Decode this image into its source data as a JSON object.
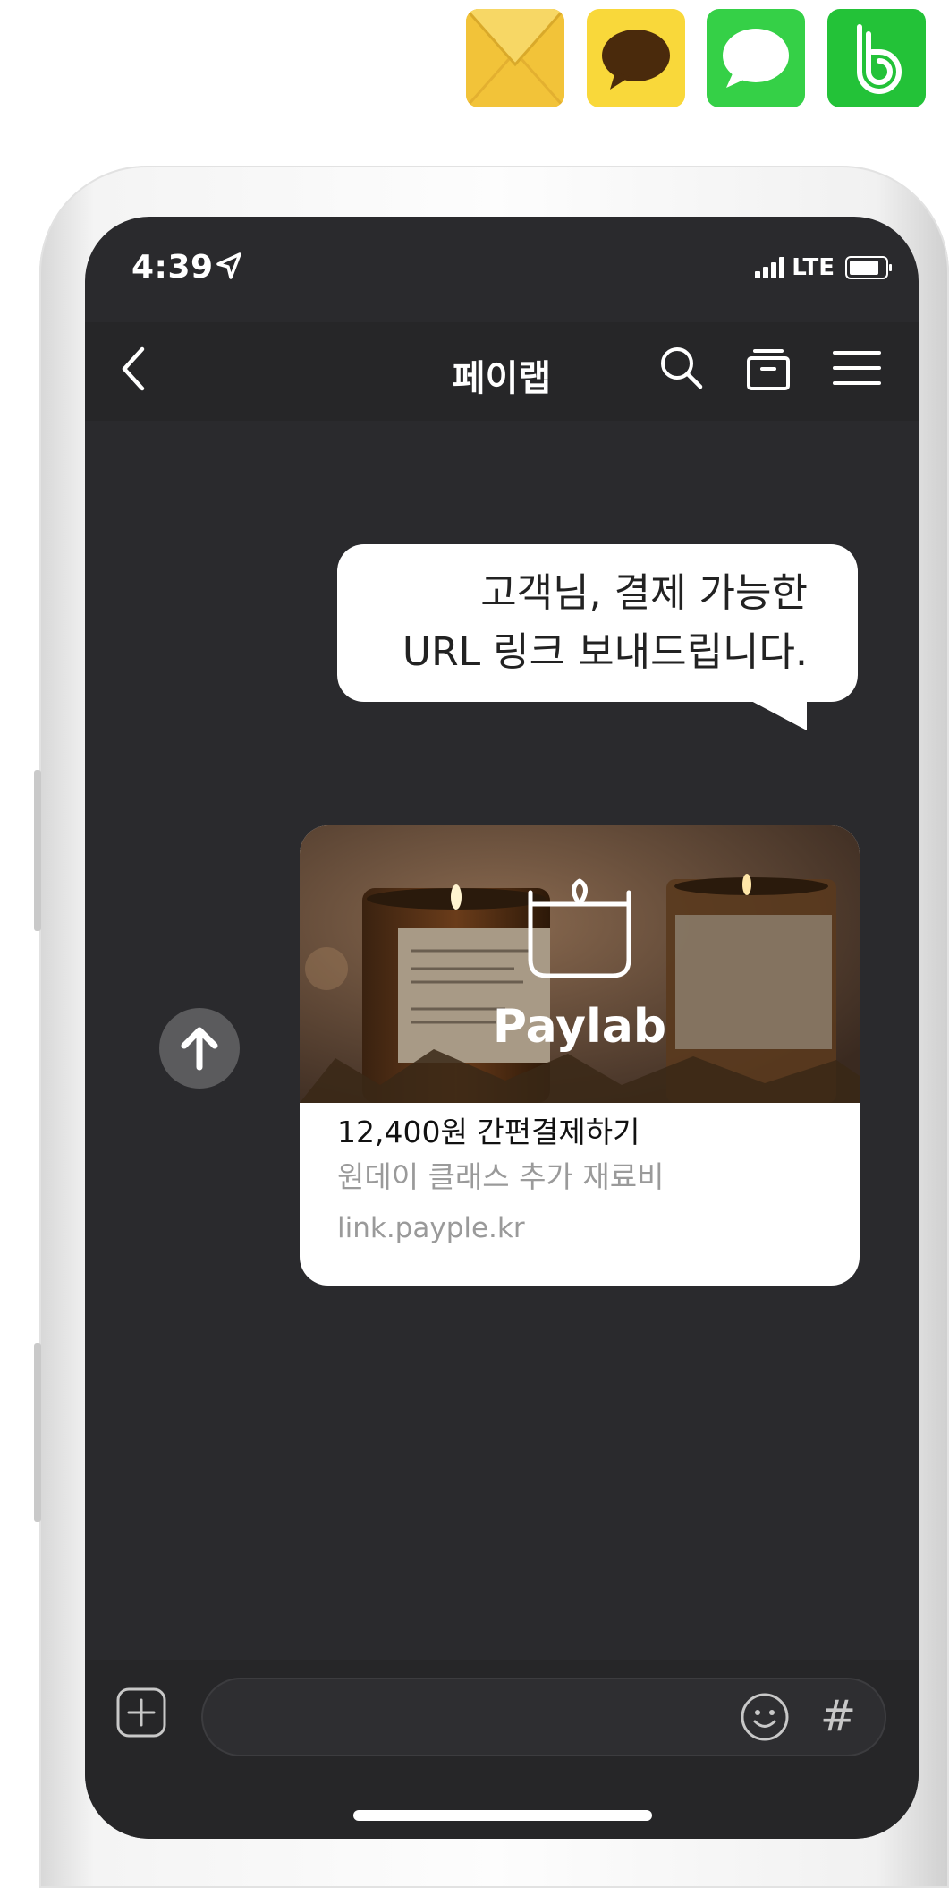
{
  "status_bar": {
    "time": "4:39",
    "network": "LTE"
  },
  "header": {
    "title": "페이랩",
    "icons": [
      "back-icon",
      "search-icon",
      "archive-icon",
      "menu-icon"
    ]
  },
  "share_apps": [
    "mail-app-icon",
    "kakaotalk-app-icon",
    "messages-app-icon",
    "band-app-icon"
  ],
  "chat": {
    "message_line1": "고객님, 결제 가능한",
    "message_line2": "URL 링크 보내드립니다.",
    "link_card": {
      "brand": "Paylab",
      "price_action": "12,400원 간편결제하기",
      "description": "원데이 클래스 추가 재료비",
      "link": "link.payple.kr"
    }
  },
  "composer": {
    "hash_label": "#",
    "icons": [
      "plus-icon",
      "emoji-icon",
      "hash-icon"
    ]
  },
  "colors": {
    "screen_bg": "#2a2a2d",
    "bubble_bg": "#ffffff",
    "kakao_yellow": "#f9d83a",
    "messages_green": "#35d047",
    "band_green": "#23c238"
  }
}
